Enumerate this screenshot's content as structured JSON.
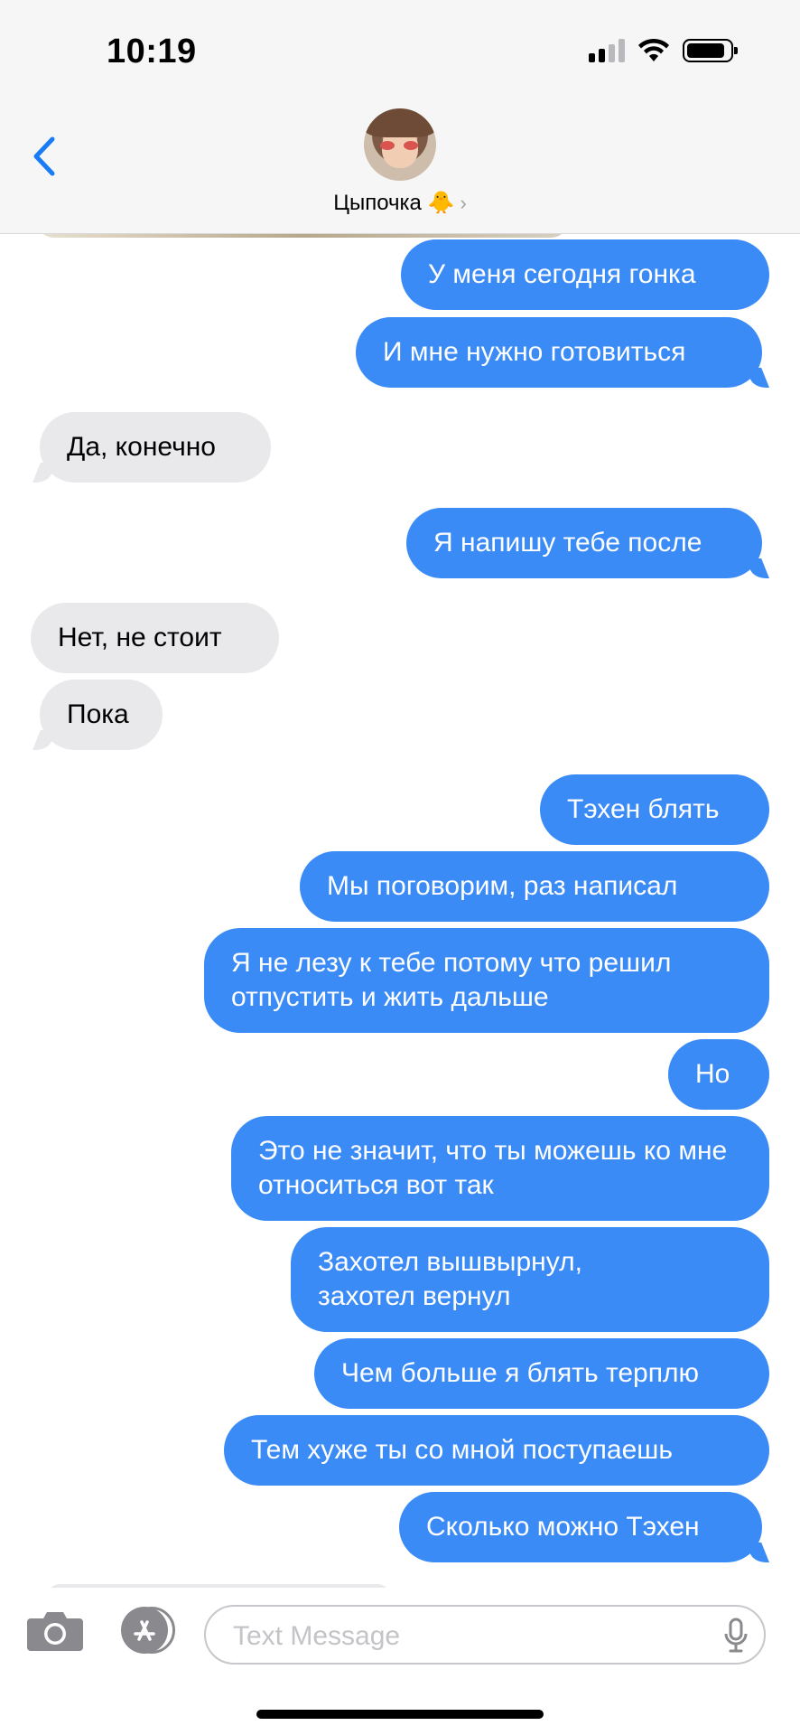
{
  "status_bar": {
    "time": "10:19",
    "icons": [
      "signal-icon",
      "wifi-icon",
      "battery-icon"
    ]
  },
  "header": {
    "contact_name": "Цыпочка 🐥",
    "chevron": "›"
  },
  "messages": [
    {
      "text": "У меня сегодня гонка",
      "sender": "me"
    },
    {
      "text": "И мне нужно готовиться",
      "sender": "me"
    },
    {
      "text": "Да, конечно",
      "sender": "them"
    },
    {
      "text": "Я напишу тебе после",
      "sender": "me"
    },
    {
      "text": "Нет, не стоит",
      "sender": "them"
    },
    {
      "text": "Пока",
      "sender": "them"
    },
    {
      "text": "Тэхен блять",
      "sender": "me"
    },
    {
      "text": "Мы поговорим, раз написал",
      "sender": "me"
    },
    {
      "text": "Я не лезу к тебе потому что решил отпустить и жить дальше",
      "sender": "me"
    },
    {
      "text": "Но",
      "sender": "me"
    },
    {
      "text": "Это не значит, что ты можешь ко мне относиться вот так",
      "sender": "me"
    },
    {
      "text": "Захотел вышвырнул, захотел вернул",
      "sender": "me"
    },
    {
      "text": "Чем больше я блять терплю",
      "sender": "me"
    },
    {
      "text": "Тем хуже ты со мной поступаешь",
      "sender": "me"
    },
    {
      "text": "Сколько можно Тэхен",
      "sender": "me"
    }
  ],
  "input_bar": {
    "placeholder": "Text Message",
    "icons": [
      "camera-icon",
      "app-store-icon",
      "microphone-icon"
    ]
  },
  "colors": {
    "sent_bubble": "#3b8bf7",
    "received_bubble": "#e9e9eb",
    "accent": "#1a7cf5"
  }
}
